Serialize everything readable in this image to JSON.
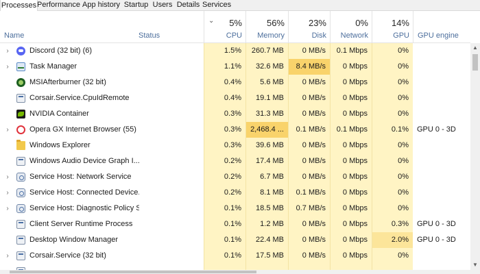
{
  "tabs": [
    "Processes",
    "Performance",
    "App history",
    "Startup",
    "Users",
    "Details",
    "Services"
  ],
  "columns": {
    "name": "Name",
    "status": "Status",
    "cpu": {
      "pct": "5%",
      "label": "CPU"
    },
    "memory": {
      "pct": "56%",
      "label": "Memory"
    },
    "disk": {
      "pct": "23%",
      "label": "Disk"
    },
    "network": {
      "pct": "0%",
      "label": "Network"
    },
    "gpu": {
      "pct": "14%",
      "label": "GPU"
    },
    "gpu_engine": "GPU engine"
  },
  "colors": {
    "heat_light": "#fff4c4",
    "heat_mid": "#fce59a",
    "heat_strong": "#f9d36b"
  },
  "processes": [
    {
      "name": "Discord (32 bit) (6)",
      "icon": "discord-icon",
      "expandable": true,
      "cpu": "1.5%",
      "memory": "260.7 MB",
      "disk": "0 MB/s",
      "network": "0.1 Mbps",
      "gpu": "0%",
      "gpu_engine": ""
    },
    {
      "name": "Task Manager",
      "icon": "task-manager-icon",
      "expandable": true,
      "cpu": "1.1%",
      "memory": "32.6 MB",
      "disk": "8.4 MB/s",
      "network": "0 Mbps",
      "gpu": "0%",
      "gpu_engine": ""
    },
    {
      "name": "MSIAfterburner (32 bit)",
      "icon": "msi-afterburner-icon",
      "expandable": false,
      "cpu": "0.4%",
      "memory": "5.6 MB",
      "disk": "0 MB/s",
      "network": "0 Mbps",
      "gpu": "0%",
      "gpu_engine": ""
    },
    {
      "name": "Corsair.Service.CpuIdRemote",
      "icon": "application-icon",
      "expandable": false,
      "cpu": "0.4%",
      "memory": "19.1 MB",
      "disk": "0 MB/s",
      "network": "0 Mbps",
      "gpu": "0%",
      "gpu_engine": ""
    },
    {
      "name": "NVIDIA Container",
      "icon": "nvidia-icon",
      "expandable": false,
      "cpu": "0.3%",
      "memory": "31.3 MB",
      "disk": "0 MB/s",
      "network": "0 Mbps",
      "gpu": "0%",
      "gpu_engine": ""
    },
    {
      "name": "Opera GX Internet Browser (55)",
      "icon": "opera-gx-icon",
      "expandable": true,
      "cpu": "0.3%",
      "memory": "2,468.4 ...",
      "disk": "0.1 MB/s",
      "network": "0.1 Mbps",
      "gpu": "0.1%",
      "gpu_engine": "GPU 0 - 3D"
    },
    {
      "name": "Windows Explorer",
      "icon": "folder-icon",
      "expandable": false,
      "cpu": "0.3%",
      "memory": "39.6 MB",
      "disk": "0 MB/s",
      "network": "0 Mbps",
      "gpu": "0%",
      "gpu_engine": ""
    },
    {
      "name": "Windows Audio Device Graph I...",
      "icon": "application-icon",
      "expandable": false,
      "cpu": "0.2%",
      "memory": "17.4 MB",
      "disk": "0 MB/s",
      "network": "0 Mbps",
      "gpu": "0%",
      "gpu_engine": ""
    },
    {
      "name": "Service Host: Network Service",
      "icon": "gear-icon",
      "expandable": true,
      "cpu": "0.2%",
      "memory": "6.7 MB",
      "disk": "0 MB/s",
      "network": "0 Mbps",
      "gpu": "0%",
      "gpu_engine": ""
    },
    {
      "name": "Service Host: Connected Device...",
      "icon": "gear-icon",
      "expandable": true,
      "cpu": "0.2%",
      "memory": "8.1 MB",
      "disk": "0.1 MB/s",
      "network": "0 Mbps",
      "gpu": "0%",
      "gpu_engine": ""
    },
    {
      "name": "Service Host: Diagnostic Policy S...",
      "icon": "gear-icon",
      "expandable": true,
      "cpu": "0.1%",
      "memory": "18.5 MB",
      "disk": "0.7 MB/s",
      "network": "0 Mbps",
      "gpu": "0%",
      "gpu_engine": ""
    },
    {
      "name": "Client Server Runtime Process",
      "icon": "application-icon",
      "expandable": false,
      "cpu": "0.1%",
      "memory": "1.2 MB",
      "disk": "0 MB/s",
      "network": "0 Mbps",
      "gpu": "0.3%",
      "gpu_engine": "GPU 0 - 3D"
    },
    {
      "name": "Desktop Window Manager",
      "icon": "application-icon",
      "expandable": false,
      "cpu": "0.1%",
      "memory": "22.4 MB",
      "disk": "0 MB/s",
      "network": "0 Mbps",
      "gpu": "2.0%",
      "gpu_engine": "GPU 0 - 3D"
    },
    {
      "name": "Corsair.Service (32 bit)",
      "icon": "application-icon",
      "expandable": true,
      "cpu": "0.1%",
      "memory": "17.5 MB",
      "disk": "0 MB/s",
      "network": "0 Mbps",
      "gpu": "0%",
      "gpu_engine": ""
    },
    {
      "name": "",
      "icon": "application-icon",
      "expandable": true,
      "cpu": "",
      "memory": "",
      "disk": "",
      "network": "",
      "gpu": "",
      "gpu_engine": ""
    }
  ]
}
